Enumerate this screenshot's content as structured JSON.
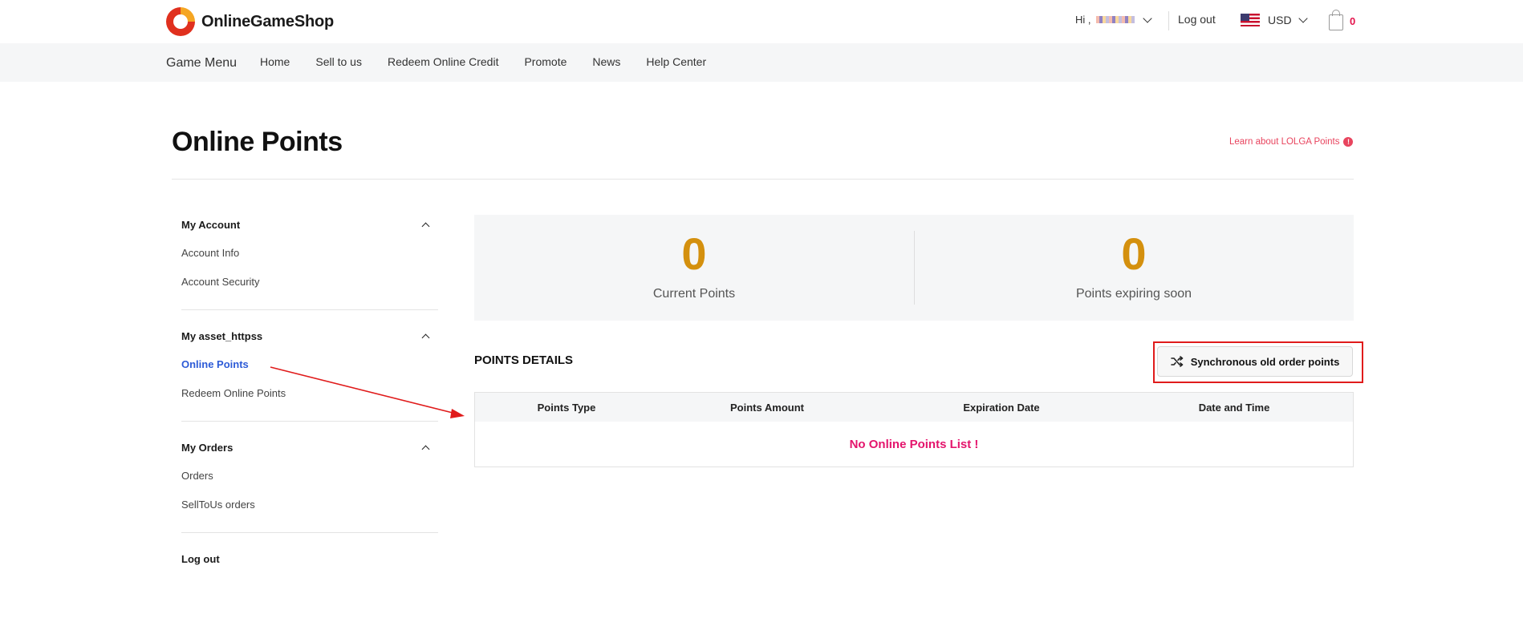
{
  "header": {
    "brand": "OnlineGameShop",
    "greeting": "Hi ,",
    "logout": "Log out",
    "currency": "USD",
    "cart_count": "0"
  },
  "nav": {
    "game_menu": "Game Menu",
    "links": [
      "Home",
      "Sell to us",
      "Redeem Online Credit",
      "Promote",
      "News",
      "Help Center"
    ]
  },
  "page": {
    "title": "Online Points",
    "learn_link": "Learn about LOLGA Points",
    "learn_icon": "!"
  },
  "sidebar": {
    "groups": [
      {
        "title": "My Account",
        "items": [
          "Account Info",
          "Account Security"
        ]
      },
      {
        "title": "My asset_httpss",
        "items": [
          "Online Points",
          "Redeem Online Points"
        ],
        "active": "Online Points"
      },
      {
        "title": "My Orders",
        "items": [
          "Orders",
          "SellToUs orders"
        ]
      }
    ],
    "logout": "Log out"
  },
  "stats": {
    "current_points": "0",
    "current_points_label": "Current Points",
    "expiring_points": "0",
    "expiring_points_label": "Points expiring soon"
  },
  "points_details": {
    "title": "POINTS DETAILS",
    "sync_button": "Synchronous old order points",
    "columns": [
      "Points Type",
      "Points Amount",
      "Expiration Date",
      "Date and Time"
    ],
    "empty_message": "No Online Points List !"
  },
  "colors": {
    "accent_red": "#e4144c",
    "points_gold": "#d4900e",
    "active_link": "#2d5bd7",
    "empty_pink": "#e4146c",
    "annotation_red": "#e01b1b"
  },
  "icons": [
    "logo-icon",
    "chevron-down-icon",
    "us-flag-icon",
    "shopping-bag-icon",
    "info-icon",
    "chevron-up-icon",
    "shuffle-icon"
  ]
}
